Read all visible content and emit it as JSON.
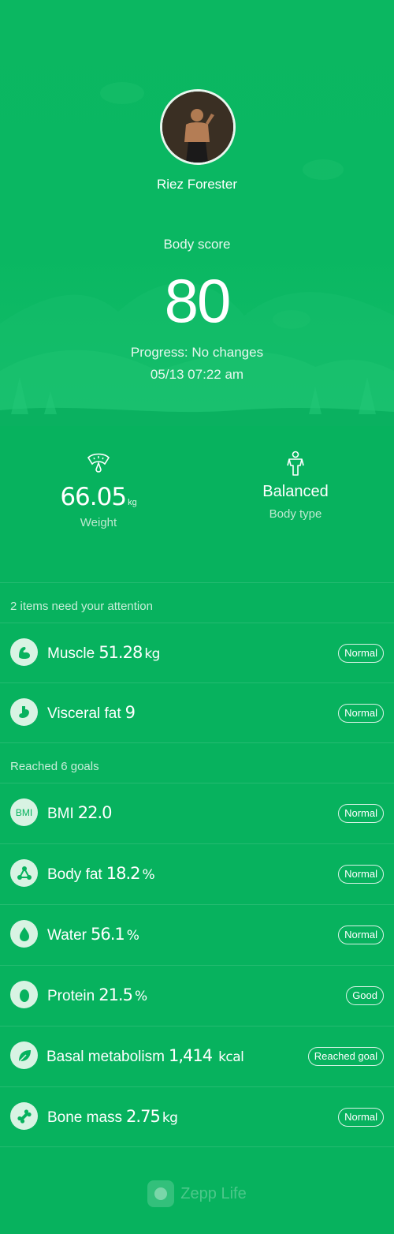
{
  "profile": {
    "name": "Riez Forester"
  },
  "score": {
    "label": "Body score",
    "value": "80",
    "progress": "Progress: No changes",
    "datetime": "05/13 07:22 am"
  },
  "summary": {
    "weight": {
      "value": "66.05",
      "unit": "kg",
      "label": "Weight",
      "icon": "scale-icon"
    },
    "body_type": {
      "value": "Balanced",
      "label": "Body type",
      "icon": "body-type-icon"
    }
  },
  "attention": {
    "heading": "2 items need your attention",
    "items": [
      {
        "icon": "muscle-icon",
        "label": "Muscle",
        "value": "51.28",
        "unit": "kg",
        "status": "Normal"
      },
      {
        "icon": "visceral-fat-icon",
        "label": "Visceral fat",
        "value": "9",
        "unit": "",
        "status": "Normal"
      }
    ]
  },
  "goals": {
    "heading": "Reached 6 goals",
    "items": [
      {
        "icon": "bmi-icon",
        "icon_text": "BMI",
        "label": "BMI",
        "value": "22.0",
        "unit": "",
        "status": "Normal"
      },
      {
        "icon": "body-fat-icon",
        "label": "Body fat",
        "value": "18.2",
        "unit": "%",
        "status": "Normal"
      },
      {
        "icon": "water-icon",
        "label": "Water",
        "value": "56.1",
        "unit": "%",
        "status": "Normal"
      },
      {
        "icon": "protein-icon",
        "label": "Protein",
        "value": "21.5",
        "unit": "%",
        "status": "Good"
      },
      {
        "icon": "leaf-icon",
        "label": "Basal metabolism",
        "value": "1,414",
        "unit": "kcal",
        "status": "Reached goal"
      },
      {
        "icon": "bone-icon",
        "label": "Bone mass",
        "value": "2.75",
        "unit": "kg",
        "status": "Normal"
      }
    ]
  },
  "footer": {
    "brand": "Zepp Life"
  },
  "colors": {
    "background": "#07b25e",
    "icon_bg": "#d8f3e3"
  }
}
